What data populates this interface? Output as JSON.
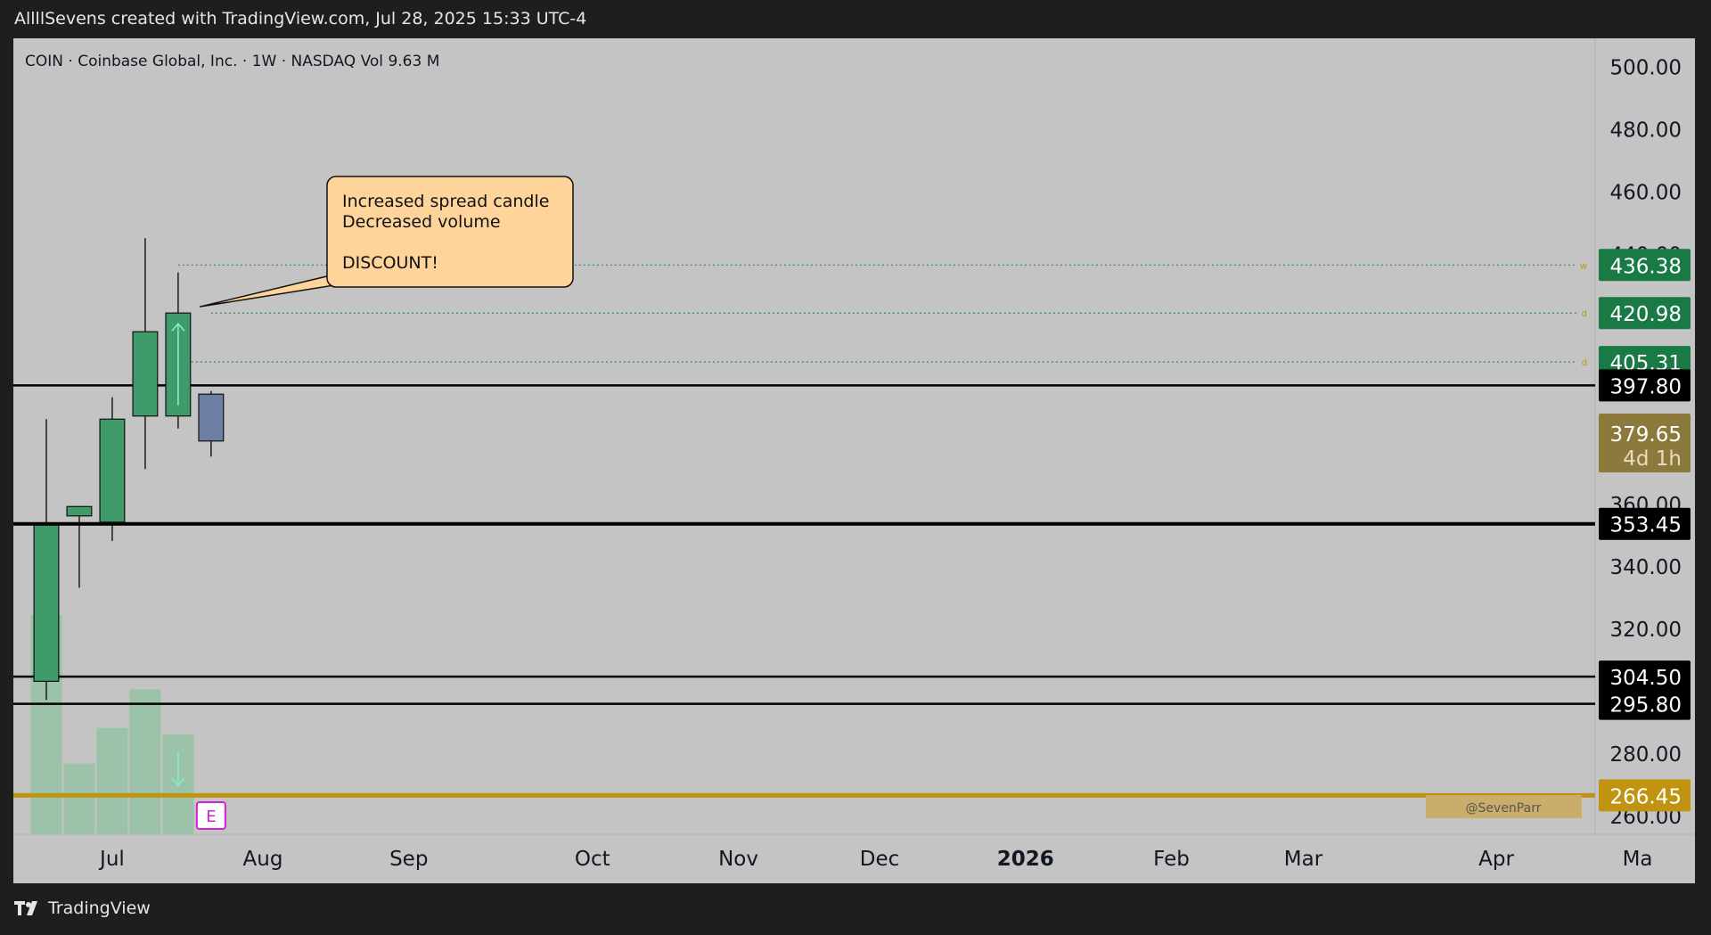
{
  "header": {
    "attribution": "AllllSevens created with TradingView.com, Jul 28, 2025 15:33 UTC-4"
  },
  "footer": {
    "brand": "TradingView"
  },
  "colors": {
    "background": "#c4c4c4",
    "page": "#1e1e1e",
    "bull": "#3f9c6a",
    "bear": "#6e7fa6",
    "level": "#000000",
    "gold": "#c09410",
    "green_tag": "#1a7a45",
    "timer_tag": "#8c7a3c",
    "callout": "#ffd49a",
    "axis_text": "#131722"
  },
  "chart_data": {
    "type": "candlestick",
    "legend": {
      "symbol": "COIN",
      "name": "Coinbase Global, Inc.",
      "interval": "1W",
      "exchange": "NASDAQ",
      "volume_label": "Vol",
      "volume_value": "9.63 M"
    },
    "y_axis": {
      "ylim": [
        254,
        509
      ],
      "ticks": [
        "500.00",
        "480.00",
        "460.00",
        "440.00",
        "360.00",
        "340.00",
        "320.00",
        "280.00",
        "260.00"
      ]
    },
    "x_axis": {
      "range": [
        "2025-06-09",
        "2026-05-11"
      ],
      "ticks": [
        {
          "label": "Jul",
          "date": "2025-06-30",
          "bold": false
        },
        {
          "label": "Aug",
          "date": "2025-08-01",
          "bold": false
        },
        {
          "label": "Sep",
          "date": "2025-09-01",
          "bold": false
        },
        {
          "label": "Oct",
          "date": "2025-10-10",
          "bold": false
        },
        {
          "label": "Nov",
          "date": "2025-11-10",
          "bold": false
        },
        {
          "label": "Dec",
          "date": "2025-12-10",
          "bold": false
        },
        {
          "label": "2026",
          "date": "2026-01-10",
          "bold": true
        },
        {
          "label": "Feb",
          "date": "2026-02-10",
          "bold": false
        },
        {
          "label": "Mar",
          "date": "2026-03-10",
          "bold": false
        },
        {
          "label": "Apr",
          "date": "2026-04-20",
          "bold": false
        },
        {
          "label": "Ma",
          "date": "2026-05-20",
          "bold": false
        }
      ]
    },
    "candles": [
      {
        "date": "2025-06-16",
        "open": 303,
        "high": 387,
        "low": 297,
        "close": 353,
        "volume": 68
      },
      {
        "date": "2025-06-23",
        "open": 356,
        "high": 359,
        "low": 333,
        "close": 359,
        "volume": 22
      },
      {
        "date": "2025-06-30",
        "open": 354,
        "high": 394,
        "low": 348,
        "close": 387,
        "volume": 33
      },
      {
        "date": "2025-07-07",
        "open": 388,
        "high": 445,
        "low": 371,
        "close": 415,
        "volume": 45
      },
      {
        "date": "2025-07-14",
        "open": 388,
        "high": 434,
        "low": 384,
        "close": 421,
        "volume": 31
      },
      {
        "date": "2025-07-21",
        "open": 395,
        "high": 396,
        "low": 375,
        "close": 380,
        "volume": 0
      }
    ],
    "volume_max": 70,
    "levels": [
      {
        "value": 397.8,
        "label": "397.80",
        "color": "#000000",
        "width": 2.5,
        "style": "solid",
        "tag_bg": "#000000"
      },
      {
        "value": 353.45,
        "label": "353.45",
        "color": "#000000",
        "width": 4,
        "style": "solid",
        "tag_bg": "#000000"
      },
      {
        "value": 304.5,
        "label": "304.50",
        "color": "#000000",
        "width": 2.5,
        "style": "solid",
        "tag_bg": "#000000"
      },
      {
        "value": 295.8,
        "label": "295.80",
        "color": "#000000",
        "width": 2.5,
        "style": "solid",
        "tag_bg": "#000000"
      },
      {
        "value": 266.45,
        "label": "266.45",
        "color": "#c09410",
        "width": 5,
        "style": "solid",
        "tag_bg": "#c09410"
      }
    ],
    "dotted_levels": [
      {
        "value": 436.38,
        "label": "436.38",
        "marker": "w",
        "start_date": "2025-07-14"
      },
      {
        "value": 420.98,
        "label": "420.98",
        "marker": "d",
        "start_date": "2025-07-21"
      },
      {
        "value": 405.31,
        "label": "405.31",
        "marker": "d",
        "start_date": "2025-07-14"
      }
    ],
    "current_price": {
      "value": 379.65,
      "label": "379.65",
      "countdown": "4d 1h"
    },
    "callout": {
      "lines": [
        "Increased spread candle",
        "Decreased volume",
        "",
        "DISCOUNT!"
      ],
      "pointer_price": 423
    },
    "arrows": [
      {
        "type": "up",
        "candle_index": 4,
        "pane": "price"
      },
      {
        "type": "down",
        "candle_index": 4,
        "pane": "volume"
      }
    ],
    "earnings_marker": {
      "label": "E",
      "candle_index": 5
    },
    "watermark": "@SevenParr"
  }
}
